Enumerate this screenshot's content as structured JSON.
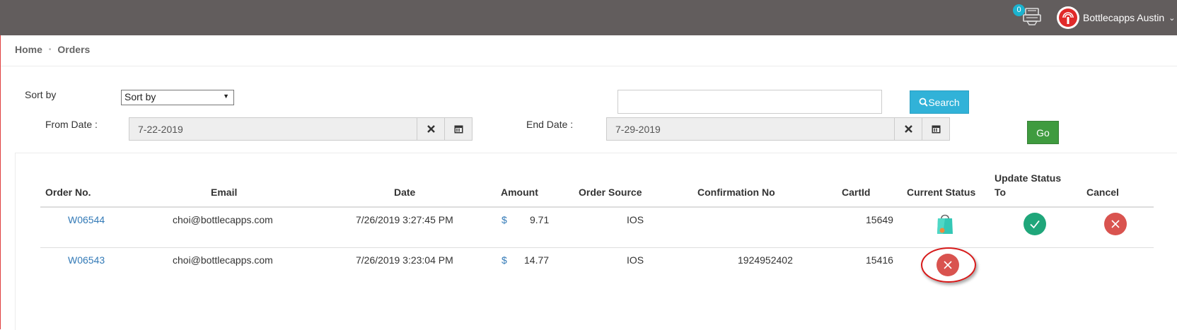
{
  "topbar": {
    "cart_count": "0",
    "user_name": "Bottlecapps Austin"
  },
  "breadcrumb": [
    "Home",
    "Orders"
  ],
  "filters": {
    "sort_label": "Sort by",
    "sort_selected": "Sort by",
    "search_value": "",
    "search_button": "Search",
    "from_label": "From Date :",
    "from_value": "7-22-2019",
    "end_label": "End Date :",
    "end_value": "7-29-2019",
    "go_button": "Go"
  },
  "table": {
    "headers": {
      "order_no": "Order No.",
      "email": "Email",
      "date": "Date",
      "amount": "Amount",
      "order_source": "Order Source",
      "confirmation_no": "Confirmation No",
      "cart_id": "CartId",
      "current_status": "Current Status",
      "update_status_line1": "Update Status",
      "update_status_line2": "To",
      "cancel": "Cancel"
    },
    "rows": [
      {
        "order_no": "W06544",
        "email": "choi@bottlecapps.com",
        "date": "7/26/2019 3:27:45 PM",
        "currency": "$",
        "amount": "9.71",
        "source": "IOS",
        "confirmation": "",
        "cart_id": "15649",
        "current_status_icon": "shopping-bag-icon",
        "update_status_icon": "check-icon",
        "cancel_icon": "close-icon"
      },
      {
        "order_no": "W06543",
        "email": "choi@bottlecapps.com",
        "date": "7/26/2019 3:23:04 PM",
        "currency": "$",
        "amount": "14.77",
        "source": "IOS",
        "confirmation": "1924952402",
        "cart_id": "15416",
        "current_status_icon": "cancelled-icon"
      }
    ]
  },
  "colors": {
    "topbar": "#625d5d",
    "badge": "#1bb3cf",
    "search_button": "#31b2d8",
    "go_button": "#3f9b3f",
    "accept": "#1fa67a",
    "cancel": "#d9534f",
    "link": "#337ab7",
    "highlight": "#d71a1a"
  }
}
